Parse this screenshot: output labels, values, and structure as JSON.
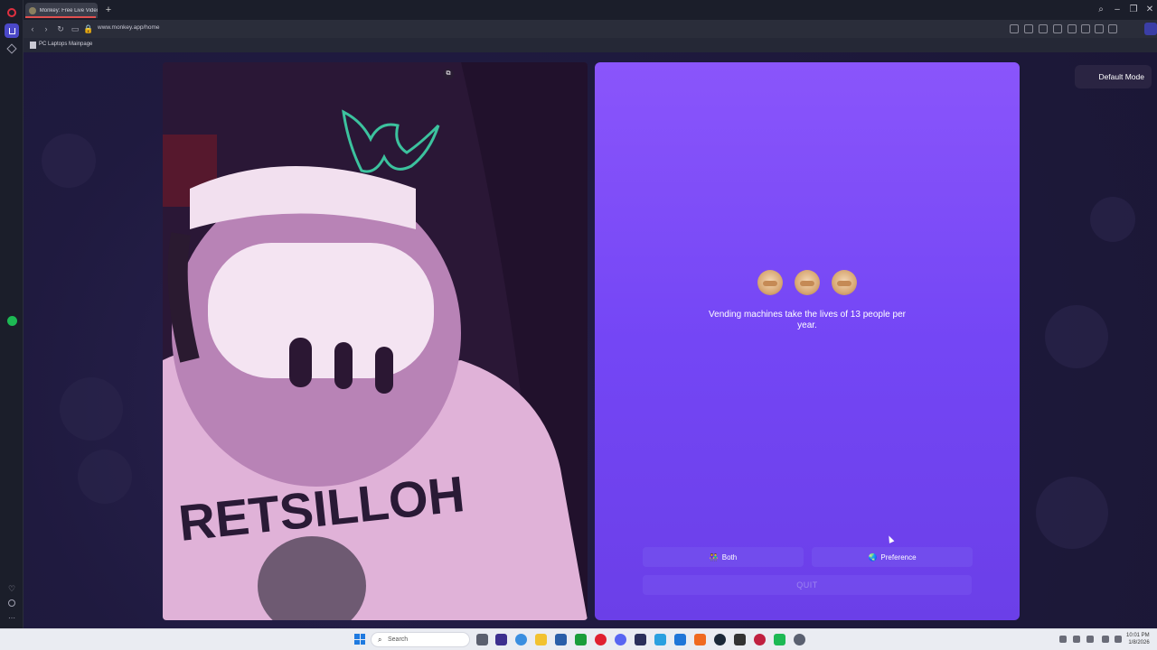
{
  "browser": {
    "tab_title": "Monkey: Free Live Video",
    "new_tab_label": "+",
    "url": "www.monkey.app/home",
    "bookmark_label": "PC Laptops Mainpage"
  },
  "video": {
    "pip_label": "⧉"
  },
  "panel": {
    "monkey_emojis": [
      "see-no-evil-monkey",
      "hear-no-evil-monkey",
      "speak-no-evil-monkey"
    ],
    "fact_text": "Vending machines take the lives of 13 people per year.",
    "both_label": "Both",
    "both_icon": "👫",
    "preference_label": "Preference",
    "preference_icon": "🌏",
    "quit_label": "QUIT"
  },
  "mode_label": "Default Mode",
  "taskbar": {
    "search_placeholder": "Search",
    "time": "10:01 PM",
    "date": "1/8/2026"
  },
  "colors": {
    "panel_top": "#8a55fb",
    "panel_bottom": "#6b3fe8",
    "page_bg": "#1e1b3a"
  }
}
